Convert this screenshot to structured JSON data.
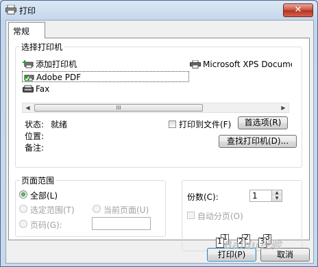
{
  "window": {
    "title": "打印",
    "close_label": "✕"
  },
  "tabs": [
    {
      "label": "常规"
    }
  ],
  "select_printer": {
    "group_label": "选择打印机",
    "printers": [
      {
        "name": "添加打印机",
        "icon": "add-printer-icon"
      },
      {
        "name": "Microsoft XPS Docume",
        "icon": "printer-icon"
      },
      {
        "name": "Adobe PDF",
        "icon": "default-printer-icon",
        "selected": true
      },
      {
        "name": "Fax",
        "icon": "fax-icon"
      }
    ],
    "scrollbar_grip": "III",
    "status_label": "状态:",
    "status_value": "就绪",
    "location_label": "位置:",
    "comment_label": "备注:",
    "print_to_file_label": "打印到文件(F)",
    "print_to_file_checked": false,
    "preferences_button": "首选项(R)",
    "find_printer_button": "查找打印机(D)..."
  },
  "page_range": {
    "group_label": "页面范围",
    "all_label": "全部(L)",
    "all_checked": true,
    "selection_label": "选定范围(T)",
    "current_page_label": "当前页面(U)",
    "pages_label": "页码(G):",
    "pages_value": ""
  },
  "copies": {
    "label": "份数(C):",
    "value": "1",
    "collate_label": "自动分页(O)",
    "collate_checked": false,
    "collate_pages": [
      "1",
      "1",
      "2",
      "2",
      "3",
      "3"
    ]
  },
  "footer": {
    "print_button": "打印(P)",
    "cancel_button": "取消"
  },
  "watermark": "Baidu经验"
}
